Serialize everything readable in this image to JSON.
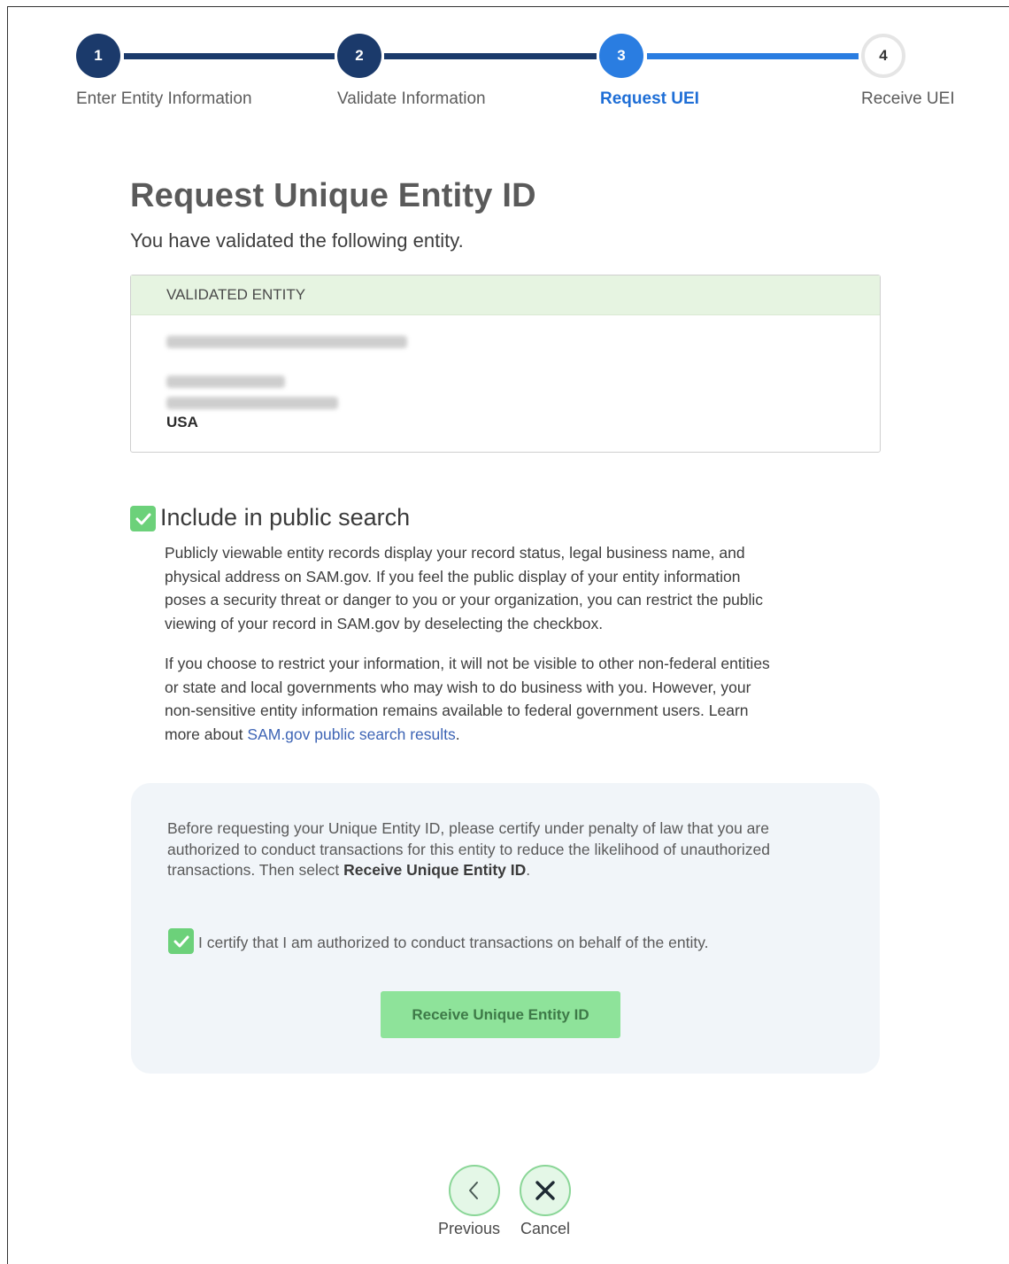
{
  "stepper": {
    "steps": [
      {
        "number": "1",
        "label": "Enter Entity Information",
        "state": "complete"
      },
      {
        "number": "2",
        "label": "Validate Information",
        "state": "complete"
      },
      {
        "number": "3",
        "label": "Request UEI",
        "state": "active"
      },
      {
        "number": "4",
        "label": "Receive UEI",
        "state": "upcoming"
      }
    ],
    "colors": {
      "complete": "#1b3a6b",
      "active": "#2a7de1",
      "upcoming_border": "#e5e5e5"
    }
  },
  "page": {
    "title": "Request Unique Entity ID",
    "subtitle": "You have validated the following entity."
  },
  "entity": {
    "header": "VALIDATED ENTITY",
    "country": "USA"
  },
  "public_search": {
    "checked": true,
    "label": "Include in public search",
    "paragraph1": "Publicly viewable entity records display your record status, legal business name, and physical address on SAM.gov. If you feel the public display of your entity information poses a security threat or danger to you or your organization, you can restrict the public viewing of your record in SAM.gov by deselecting the checkbox.",
    "paragraph2": "If you choose to restrict your information, it will not be visible to other non-federal entities or state and local governments who may wish to do business with you. However, your non-sensitive entity information remains available to federal government users. Learn more about ",
    "link_text": "SAM.gov public search results",
    "link_suffix": "."
  },
  "certify": {
    "text_before": "Before requesting your Unique Entity ID, please certify under penalty of law that you are authorized to conduct transactions for this entity to reduce the likelihood of unauthorized transactions. Then select ",
    "text_bold": "Receive Unique Entity ID",
    "text_after": ".",
    "checkbox_checked": true,
    "checkbox_label": "I certify that I am authorized to conduct transactions on behalf of the entity.",
    "button_label": "Receive Unique Entity ID"
  },
  "footer_nav": {
    "previous_label": "Previous",
    "cancel_label": "Cancel"
  }
}
